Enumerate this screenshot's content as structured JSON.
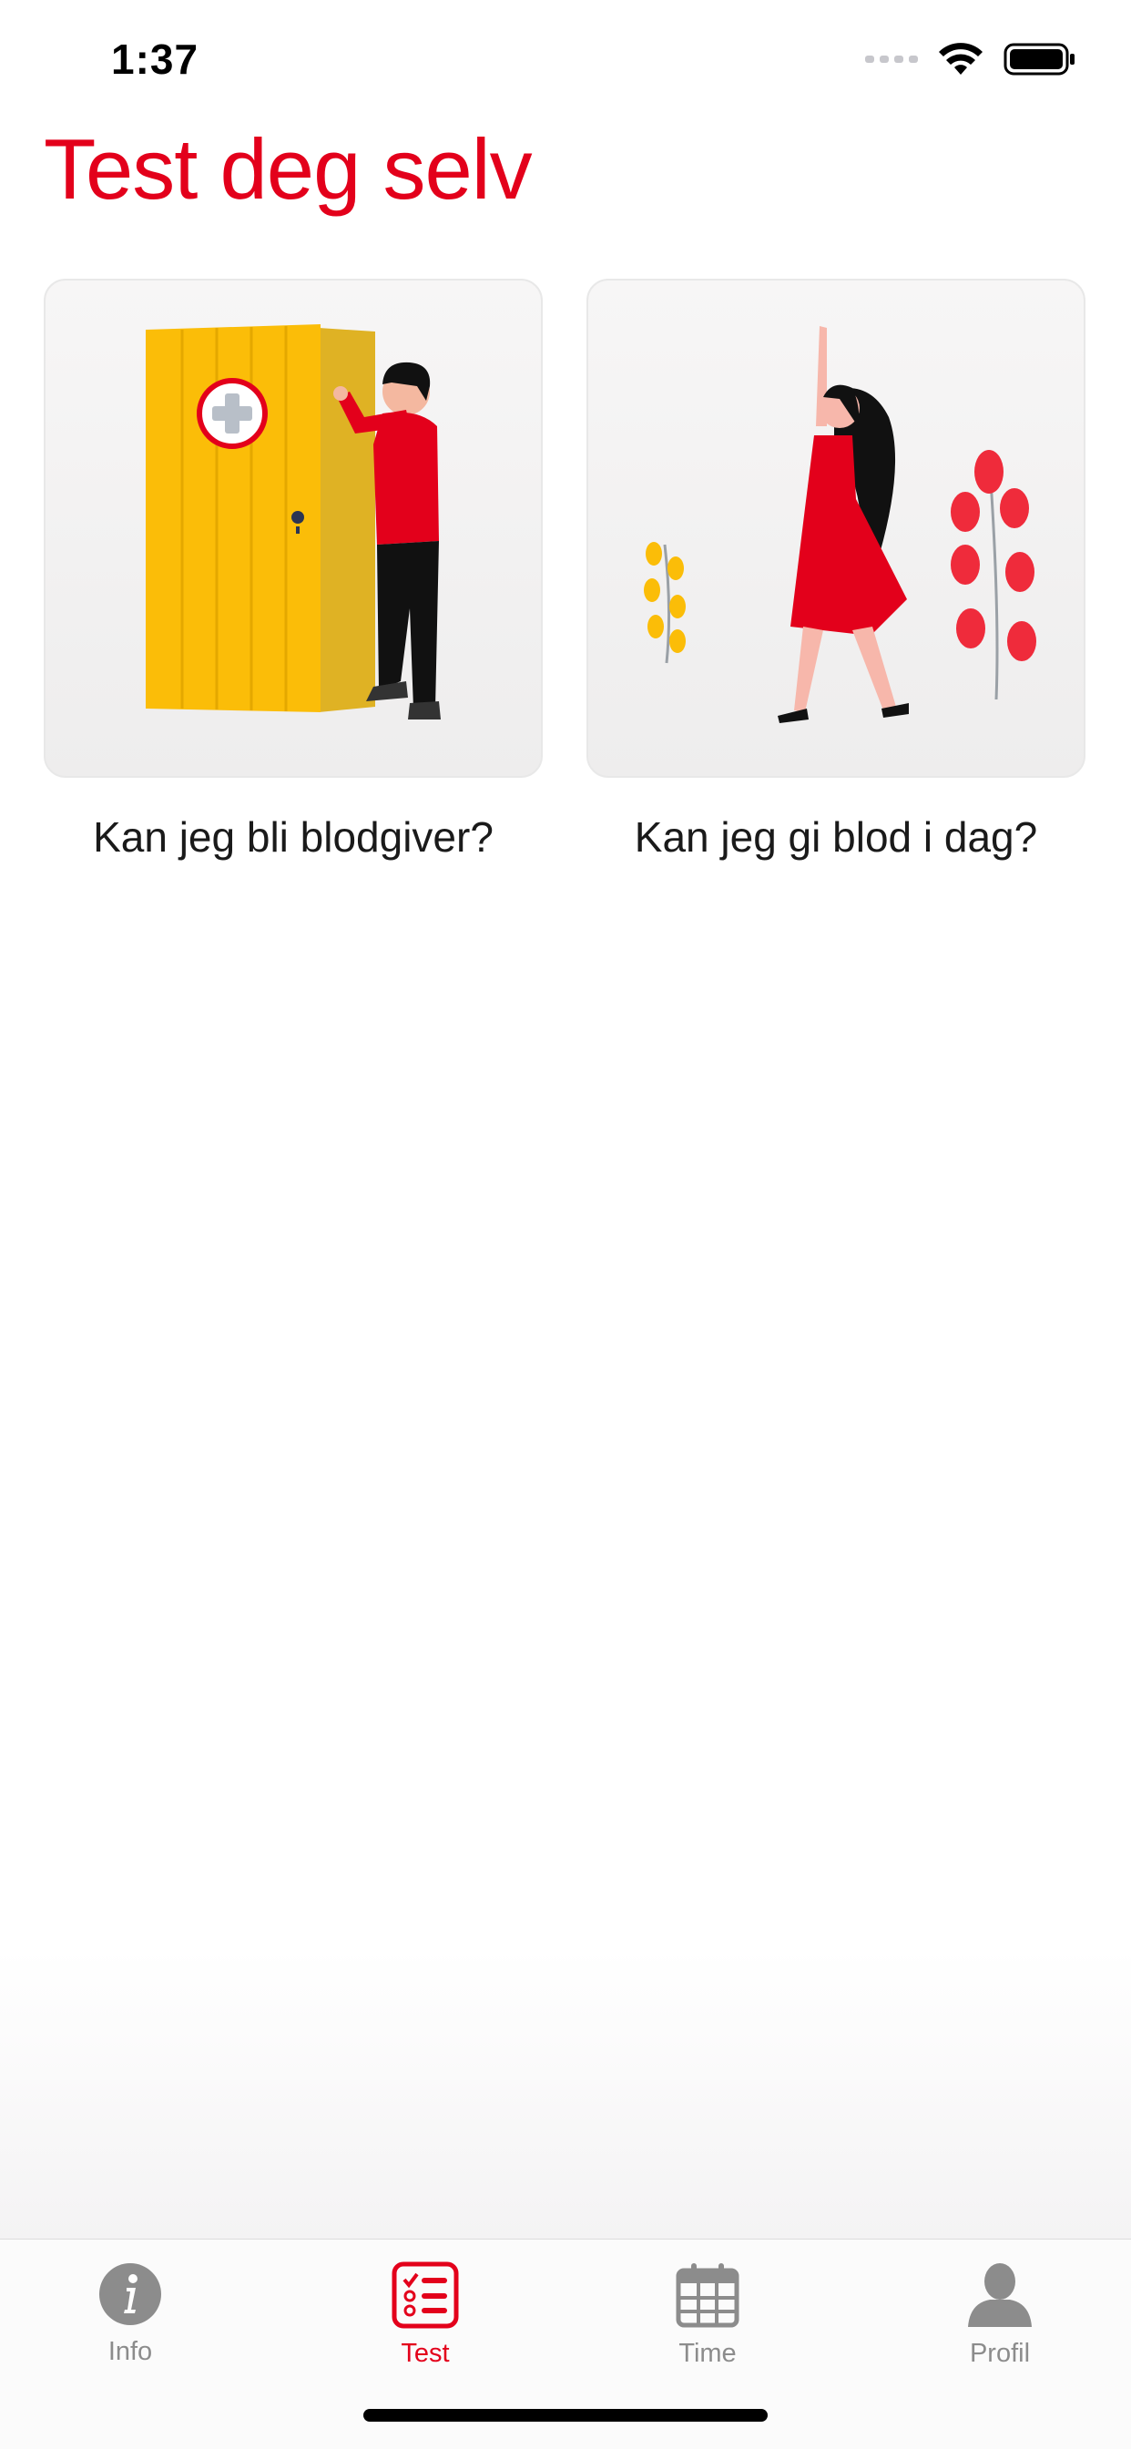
{
  "status_bar": {
    "time": "1:37"
  },
  "page": {
    "title": "Test deg selv"
  },
  "cards": [
    {
      "label": "Kan jeg bli blodgiver?",
      "icon": "door-person-illustration"
    },
    {
      "label": "Kan jeg gi blod i dag?",
      "icon": "dancing-woman-illustration"
    }
  ],
  "tab_bar": {
    "items": [
      {
        "label": "Info",
        "icon": "info-icon",
        "active": false
      },
      {
        "label": "Test",
        "icon": "checklist-icon",
        "active": true
      },
      {
        "label": "Time",
        "icon": "calendar-icon",
        "active": false
      },
      {
        "label": "Profil",
        "icon": "person-icon",
        "active": false
      }
    ]
  },
  "colors": {
    "accent": "#e3001b",
    "inactive": "#8c8c8c",
    "door_yellow": "#fbbd08"
  }
}
